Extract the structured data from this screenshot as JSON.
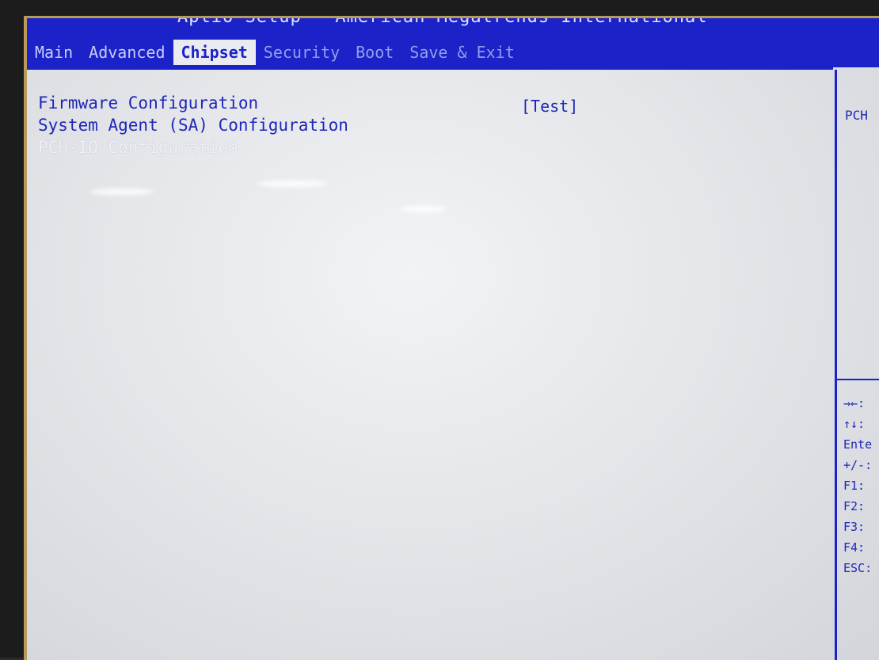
{
  "app": {
    "title": "Aptio Setup - American Megatrends International"
  },
  "tabs": [
    {
      "label": "Main"
    },
    {
      "label": "Advanced"
    },
    {
      "label": "Chipset"
    },
    {
      "label": "Security"
    },
    {
      "label": "Boot"
    },
    {
      "label": "Save & Exit"
    }
  ],
  "menu": [
    {
      "label": "Firmware Configuration",
      "value": "[Test]"
    },
    {
      "label": "System Agent (SA) Configuration"
    },
    {
      "label": "PCH-IO Configuration"
    }
  ],
  "help": {
    "text": "PCH",
    "keys": [
      "→←:",
      "↑↓:",
      "Ente",
      "+/-:",
      "F1:",
      "F2:",
      "F3:",
      "F4:",
      "ESC:"
    ]
  },
  "colors": {
    "header_blue": "#1a22c8",
    "menu_text_blue": "#1e27b8",
    "screen_bg": "#e6e8ec"
  }
}
